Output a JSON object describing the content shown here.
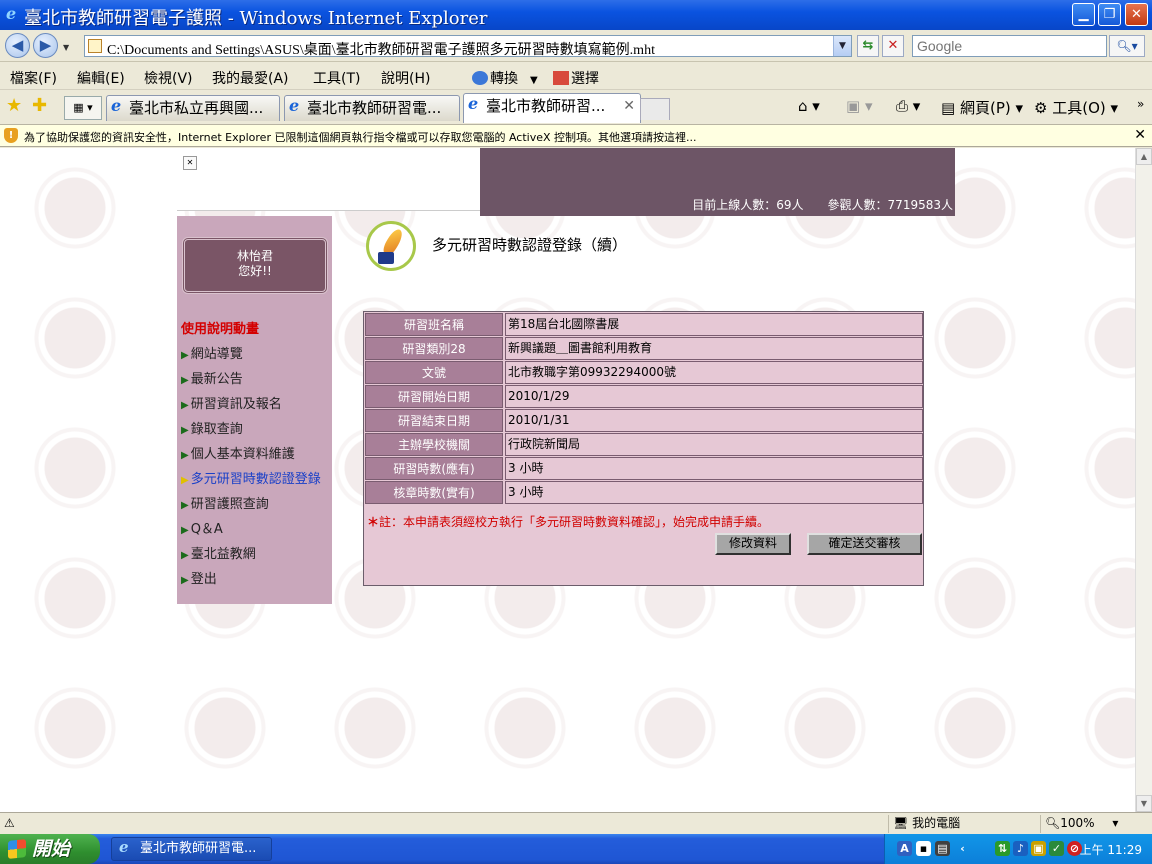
{
  "window": {
    "title": "臺北市教師研習電子護照 - Windows Internet Explorer",
    "minimize": "▁",
    "maximize": "❐",
    "close": "✕"
  },
  "address_bar": {
    "url": "C:\\Documents and Settings\\ASUS\\桌面\\臺北市教師研習電子護照多元研習時數填寫範例.mht",
    "search_placeholder": "Google"
  },
  "menu": {
    "items": [
      "檔案(F)",
      "編輯(E)",
      "檢視(V)",
      "我的最愛(A)",
      "工具(T)",
      "說明(H)"
    ],
    "convert": "轉換",
    "select": "選擇"
  },
  "tabs": [
    {
      "label": "臺北市私立再興國..."
    },
    {
      "label": "臺北市教師研習電..."
    },
    {
      "label": "臺北市教師研習...",
      "active": true
    }
  ],
  "command_bar": {
    "page": "網頁(P)",
    "tools": "工具(O)"
  },
  "info_bar": {
    "message": "為了協助保護您的資訊安全性，Internet Explorer 已限制這個網頁執行指令檔或可以存取您電腦的 ActiveX 控制項。其他選項請按這裡..."
  },
  "site": {
    "stats": "目前上線人數：69人　　參觀人數：7719583人",
    "user_name": "林怡君",
    "greeting": "您好!!",
    "sidebar_title": "使用說明動畫",
    "sidebar_items": [
      "網站導覽",
      "最新公告",
      "研習資訊及報名",
      "錄取查詢",
      "個人基本資料維護",
      "多元研習時數認證登錄",
      "研習護照查詢",
      "Q＆A",
      "臺北益教網",
      "登出"
    ],
    "active_item_index": 5,
    "page_heading": "多元研習時數認證登錄（續）"
  },
  "form": {
    "rows": [
      {
        "label": "研習班名稱",
        "value": "第18屆台北國際書展"
      },
      {
        "label": "研習類別28",
        "value": "新興議題＿圖書館利用教育"
      },
      {
        "label": "文號",
        "value": "北市教職字第09932294000號"
      },
      {
        "label": "研習開始日期",
        "value": "2010/1/29"
      },
      {
        "label": "研習結束日期",
        "value": "2010/1/31"
      },
      {
        "label": "主辦學校機關",
        "value": "行政院新聞局"
      },
      {
        "label": "研習時數(應有)",
        "value": "3 小時"
      },
      {
        "label": "核章時數(實有)",
        "value": "3 小時"
      }
    ],
    "note_mark": "＊",
    "note": "註：本申請表須經校方執行「多元研習時數資料確認」，始完成申請手續。",
    "edit_button": "修改資料",
    "submit_button": "確定送交審核"
  },
  "status_bar": {
    "zone": "我的電腦",
    "zoom": "100%"
  },
  "taskbar": {
    "start": "開始",
    "window_item": "臺北市教師研習電...",
    "clock": "上午 11:29"
  },
  "colors": {
    "title_bar": "#0a53e0",
    "sidebar_bg": "#c9a7bb",
    "header_bg": "#6d5566",
    "label_bg": "#a87f98",
    "form_bg": "#e6c8d5",
    "warning_red": "#d10000"
  }
}
